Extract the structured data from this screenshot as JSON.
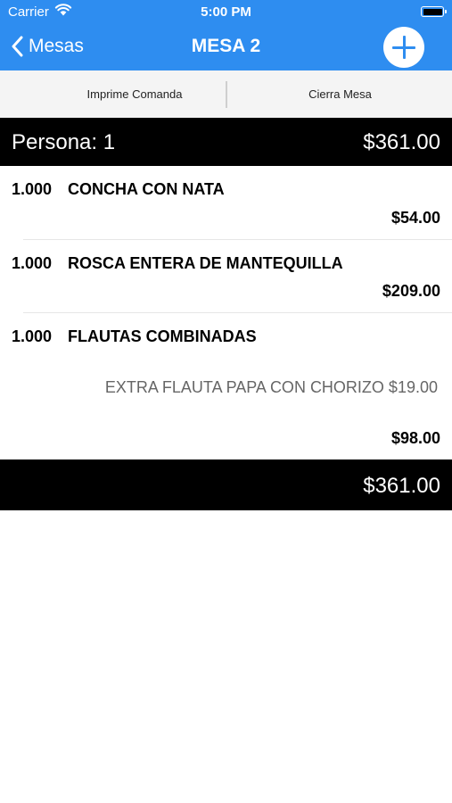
{
  "status_bar": {
    "carrier": "Carrier",
    "time": "5:00 PM"
  },
  "nav": {
    "back_label": "Mesas",
    "title": "MESA 2"
  },
  "toolbar": {
    "print_label": "Imprime Comanda",
    "close_label": "Cierra Mesa"
  },
  "person_header": {
    "label": "Persona: 1",
    "total": "$361.00"
  },
  "items": [
    {
      "qty": "1.000",
      "name": "CONCHA CON NATA",
      "price": "$54.00"
    },
    {
      "qty": "1.000",
      "name": "ROSCA ENTERA DE MANTEQUILLA",
      "price": "$209.00"
    },
    {
      "qty": "1.000",
      "name": "FLAUTAS COMBINADAS",
      "extra": "EXTRA FLAUTA PAPA CON CHORIZO $19.00",
      "price": "$98.00"
    }
  ],
  "footer": {
    "total": "$361.00"
  },
  "colors": {
    "accent": "#2e8df0",
    "bar": "#000000"
  }
}
